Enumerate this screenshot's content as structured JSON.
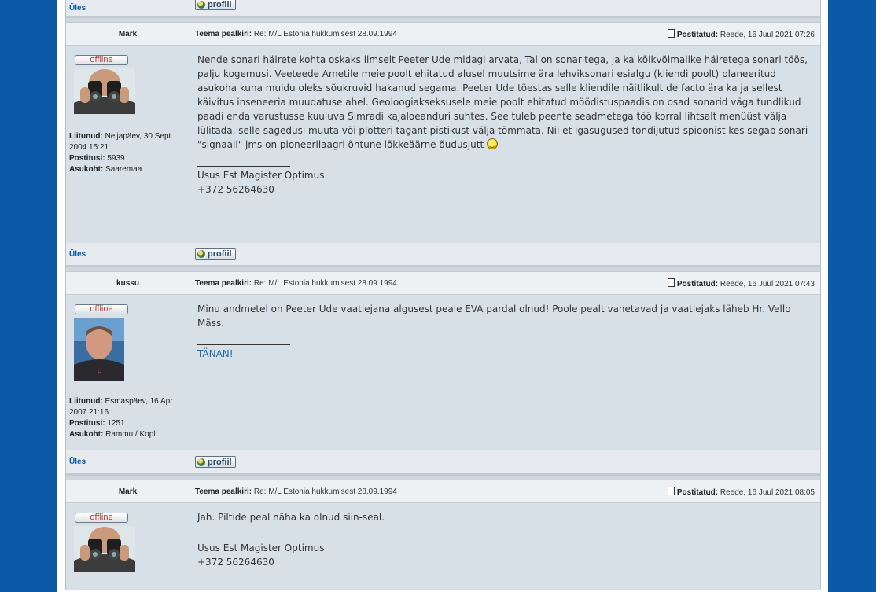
{
  "nav": {
    "up_label": "Üles",
    "profile_label": "profiil"
  },
  "labels": {
    "subject": "Teema pealkiri:",
    "posted": "Postitatud:",
    "joined": "Liitunud:",
    "posts": "Postitusi:",
    "location": "Asukoht:",
    "offline": "offline"
  },
  "posts": [
    {
      "author": "Mark",
      "subject": "Re: M/L Estonia hukkumisest 28.09.1994",
      "date": "Reede, 16 Juul 2021 07:26",
      "joined": "Neljapäev, 30 Sept 2004 15:21",
      "post_count": "5939",
      "location": "Saaremaa",
      "body": "Nende sonari häirete kohta oskaks ilmselt Peeter Ude midagi arvata, Tal on sonaritega, ja ka kõikvõimalike häiretega sonari töös, palju kogemusi. Veeteede Ametile meie poolt ehitatud alusel muutsime ära lehviksonari esialgu (kliendi poolt) planeeritud asukoha kuna muidu oleks sõukruvid hakanud segama. Peeter Ude tõestas selle kliendile näitlikult de facto ära ka ja sellest käivitus inseneeria muudatuse ahel. Geoloogiakseksusele meie poolt ehitatud möödistuspaadis on osad sonarid väga tundlikud paadi enda varustusse kuuluva Simradi kajaloeanduri suhtes. See tuleb peente seadmetega töö korral lihtsalt menüüst välja lülitada, selle sagedusi muuta või plotteri tagant pistikust välja tõmmata. Nii et igasugused tondijutud spioonist kes segab sonari \"signaali\" jms on pioneerilaagri õhtune lõkkeäärne õudusjutt",
      "sig1": "Usus Est Magister Optimus",
      "sig2": "+372 56264630"
    },
    {
      "author": "kussu",
      "subject": "Re: M/L Estonia hukkumisest 28.09.1994",
      "date": "Reede, 16 Juul 2021 07:43",
      "joined": "Esmaspäev, 16 Apr 2007 21:16",
      "post_count": "1251",
      "location": "Rammu / Kopli",
      "body": "Minu andmetel on Peeter Ude vaatlejana algusest peale EVA pardal olnud! Poole pealt vahetavad ja vaatlejaks läheb Hr. Vello Mäss.",
      "sig1": "TÄNAN!"
    },
    {
      "author": "Mark",
      "subject": "Re: M/L Estonia hukkumisest 28.09.1994",
      "date": "Reede, 16 Juul 2021 08:05",
      "body": "Jah. Piltide peal näha ka olnud siin-seal.",
      "sig1": "Usus Est Magister Optimus",
      "sig2": "+372 56264630"
    }
  ]
}
